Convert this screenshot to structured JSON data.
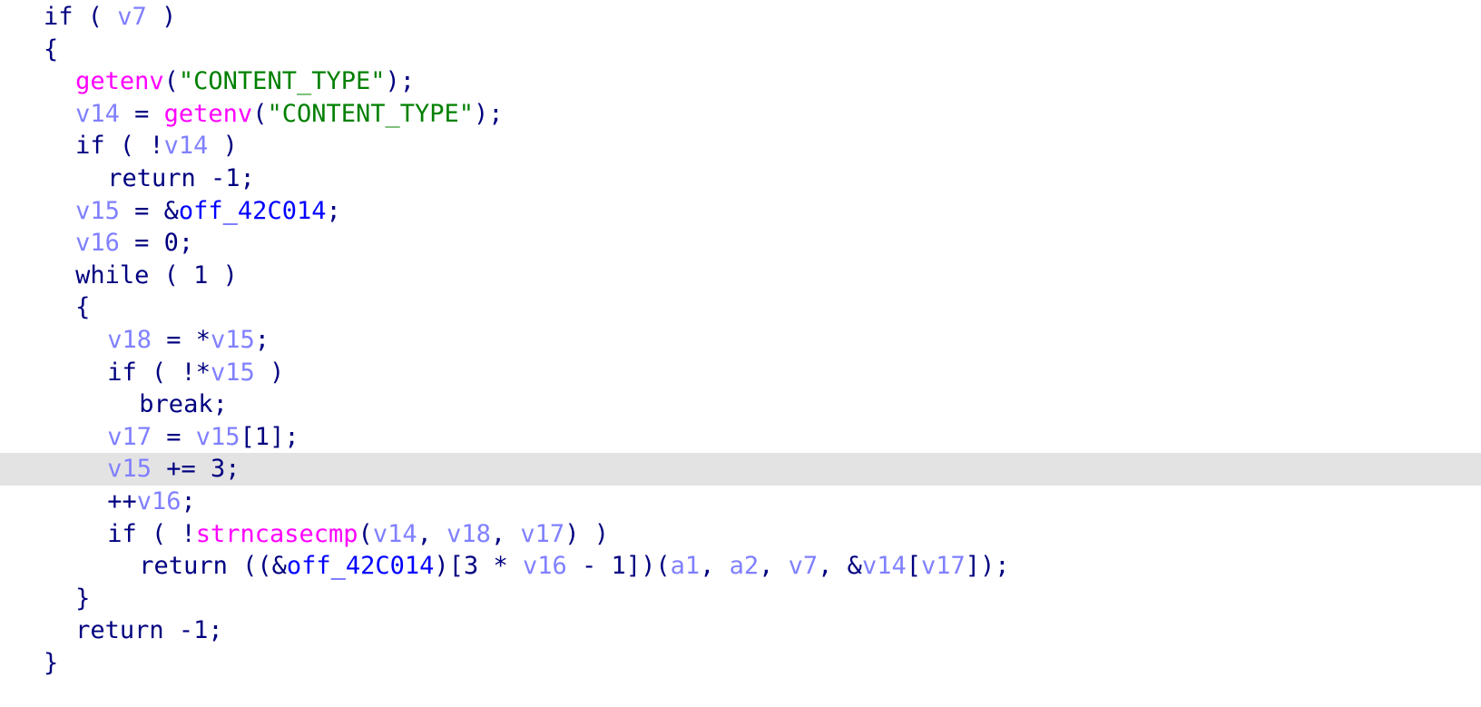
{
  "view": {
    "kind": "decompiler-pseudocode",
    "background_color": "#ffffff",
    "highlight_color": "#e3e3e3",
    "highlighted_line_index": 13
  },
  "palette": {
    "keyword": "#000080",
    "punctuation": "#000080",
    "number": "#000080",
    "local_variable": "#8080ff",
    "function_name": "#ff00ff",
    "string_literal": "#008000",
    "global_name": "#0000ff",
    "argument": "#8080ff"
  },
  "code": {
    "lines": [
      {
        "indent": 2,
        "highlighted": false,
        "tokens": [
          {
            "text": "if ( ",
            "cls": "t-kw"
          },
          {
            "text": "v7",
            "cls": "t-var"
          },
          {
            "text": " )",
            "cls": "t-punct"
          }
        ]
      },
      {
        "indent": 2,
        "highlighted": false,
        "tokens": [
          {
            "text": "{",
            "cls": "t-punct"
          }
        ]
      },
      {
        "indent": 4,
        "highlighted": false,
        "tokens": [
          {
            "text": "getenv",
            "cls": "t-func"
          },
          {
            "text": "(",
            "cls": "t-punct"
          },
          {
            "text": "\"CONTENT_TYPE\"",
            "cls": "t-str"
          },
          {
            "text": ");",
            "cls": "t-punct"
          }
        ]
      },
      {
        "indent": 4,
        "highlighted": false,
        "tokens": [
          {
            "text": "v14",
            "cls": "t-var"
          },
          {
            "text": " = ",
            "cls": "t-punct"
          },
          {
            "text": "getenv",
            "cls": "t-func"
          },
          {
            "text": "(",
            "cls": "t-punct"
          },
          {
            "text": "\"CONTENT_TYPE\"",
            "cls": "t-str"
          },
          {
            "text": ");",
            "cls": "t-punct"
          }
        ]
      },
      {
        "indent": 4,
        "highlighted": false,
        "tokens": [
          {
            "text": "if ( !",
            "cls": "t-kw"
          },
          {
            "text": "v14",
            "cls": "t-var"
          },
          {
            "text": " )",
            "cls": "t-punct"
          }
        ]
      },
      {
        "indent": 6,
        "highlighted": false,
        "tokens": [
          {
            "text": "return -1;",
            "cls": "t-kw"
          }
        ]
      },
      {
        "indent": 4,
        "highlighted": false,
        "tokens": [
          {
            "text": "v15",
            "cls": "t-var"
          },
          {
            "text": " = &",
            "cls": "t-punct"
          },
          {
            "text": "off_42C014",
            "cls": "t-glob"
          },
          {
            "text": ";",
            "cls": "t-punct"
          }
        ]
      },
      {
        "indent": 4,
        "highlighted": false,
        "tokens": [
          {
            "text": "v16",
            "cls": "t-var"
          },
          {
            "text": " = ",
            "cls": "t-punct"
          },
          {
            "text": "0",
            "cls": "t-num"
          },
          {
            "text": ";",
            "cls": "t-punct"
          }
        ]
      },
      {
        "indent": 4,
        "highlighted": false,
        "tokens": [
          {
            "text": "while ( ",
            "cls": "t-kw"
          },
          {
            "text": "1",
            "cls": "t-num"
          },
          {
            "text": " )",
            "cls": "t-punct"
          }
        ]
      },
      {
        "indent": 4,
        "highlighted": false,
        "tokens": [
          {
            "text": "{",
            "cls": "t-punct"
          }
        ]
      },
      {
        "indent": 6,
        "highlighted": false,
        "tokens": [
          {
            "text": "v18",
            "cls": "t-var"
          },
          {
            "text": " = *",
            "cls": "t-punct"
          },
          {
            "text": "v15",
            "cls": "t-var"
          },
          {
            "text": ";",
            "cls": "t-punct"
          }
        ]
      },
      {
        "indent": 6,
        "highlighted": false,
        "tokens": [
          {
            "text": "if ( !*",
            "cls": "t-kw"
          },
          {
            "text": "v15",
            "cls": "t-var"
          },
          {
            "text": " )",
            "cls": "t-punct"
          }
        ]
      },
      {
        "indent": 8,
        "highlighted": false,
        "tokens": [
          {
            "text": "break;",
            "cls": "t-kw"
          }
        ]
      },
      {
        "indent": 6,
        "highlighted": false,
        "tokens": [
          {
            "text": "v17",
            "cls": "t-var"
          },
          {
            "text": " = ",
            "cls": "t-punct"
          },
          {
            "text": "v15",
            "cls": "t-var"
          },
          {
            "text": "[",
            "cls": "t-punct"
          },
          {
            "text": "1",
            "cls": "t-num"
          },
          {
            "text": "];",
            "cls": "t-punct"
          }
        ]
      },
      {
        "indent": 6,
        "highlighted": true,
        "tokens": [
          {
            "text": "v15",
            "cls": "t-var"
          },
          {
            "text": " += ",
            "cls": "t-punct"
          },
          {
            "text": "3",
            "cls": "t-num"
          },
          {
            "text": ";",
            "cls": "t-punct"
          }
        ]
      },
      {
        "indent": 6,
        "highlighted": false,
        "tokens": [
          {
            "text": "++",
            "cls": "t-punct"
          },
          {
            "text": "v16",
            "cls": "t-var"
          },
          {
            "text": ";",
            "cls": "t-punct"
          }
        ]
      },
      {
        "indent": 6,
        "highlighted": false,
        "tokens": [
          {
            "text": "if ( !",
            "cls": "t-kw"
          },
          {
            "text": "strncasecmp",
            "cls": "t-func"
          },
          {
            "text": "(",
            "cls": "t-punct"
          },
          {
            "text": "v14",
            "cls": "t-var"
          },
          {
            "text": ", ",
            "cls": "t-punct"
          },
          {
            "text": "v18",
            "cls": "t-var"
          },
          {
            "text": ", ",
            "cls": "t-punct"
          },
          {
            "text": "v17",
            "cls": "t-var"
          },
          {
            "text": ") )",
            "cls": "t-punct"
          }
        ]
      },
      {
        "indent": 8,
        "highlighted": false,
        "tokens": [
          {
            "text": "return ((&",
            "cls": "t-kw"
          },
          {
            "text": "off_42C014",
            "cls": "t-glob"
          },
          {
            "text": ")[",
            "cls": "t-punct"
          },
          {
            "text": "3",
            "cls": "t-num"
          },
          {
            "text": " * ",
            "cls": "t-punct"
          },
          {
            "text": "v16",
            "cls": "t-var"
          },
          {
            "text": " - ",
            "cls": "t-punct"
          },
          {
            "text": "1",
            "cls": "t-num"
          },
          {
            "text": "])(",
            "cls": "t-punct"
          },
          {
            "text": "a1",
            "cls": "t-arg"
          },
          {
            "text": ", ",
            "cls": "t-punct"
          },
          {
            "text": "a2",
            "cls": "t-arg"
          },
          {
            "text": ", ",
            "cls": "t-punct"
          },
          {
            "text": "v7",
            "cls": "t-var"
          },
          {
            "text": ", &",
            "cls": "t-punct"
          },
          {
            "text": "v14",
            "cls": "t-var"
          },
          {
            "text": "[",
            "cls": "t-punct"
          },
          {
            "text": "v17",
            "cls": "t-var"
          },
          {
            "text": "]);",
            "cls": "t-punct"
          }
        ]
      },
      {
        "indent": 4,
        "highlighted": false,
        "tokens": [
          {
            "text": "}",
            "cls": "t-punct"
          }
        ]
      },
      {
        "indent": 4,
        "highlighted": false,
        "tokens": [
          {
            "text": "return -1;",
            "cls": "t-kw"
          }
        ]
      },
      {
        "indent": 2,
        "highlighted": false,
        "tokens": [
          {
            "text": "}",
            "cls": "t-punct"
          }
        ]
      }
    ]
  }
}
